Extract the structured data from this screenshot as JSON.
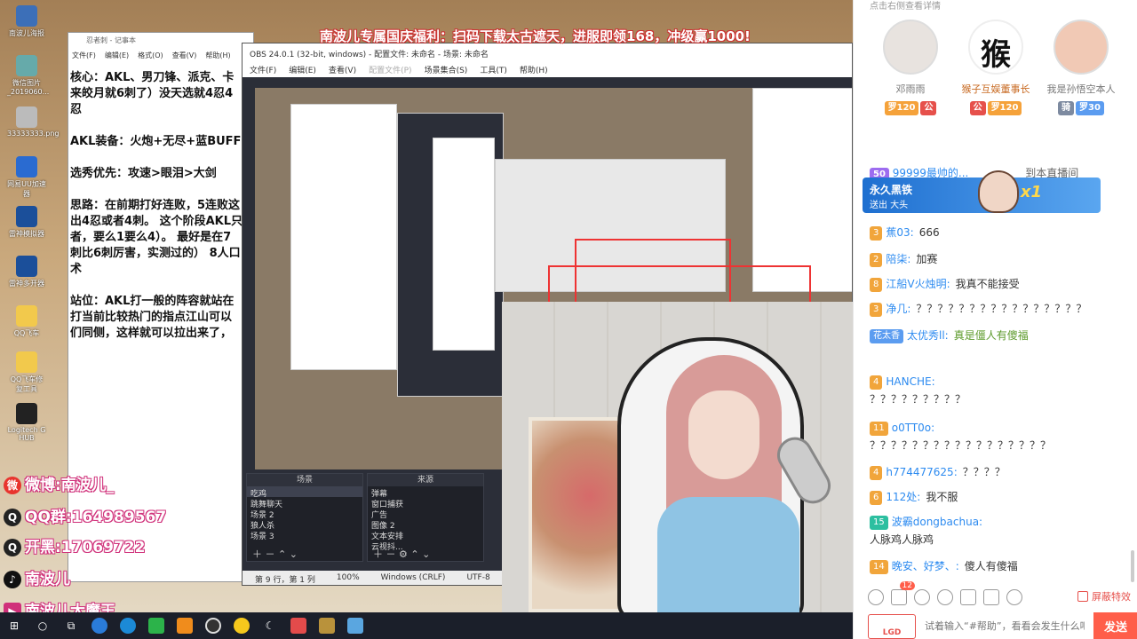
{
  "banner": "南波儿专属国庆福利：扫码下载太古遮天，进服即领168，冲级赢1000!",
  "desktop_icons": [
    {
      "label": "南波儿海报"
    },
    {
      "label": "微信图片_2019060..."
    },
    {
      "label": "33333333.png"
    },
    {
      "label": "网易UU加速器"
    },
    {
      "label": "雷神模拟器"
    },
    {
      "label": "雷神多开器"
    },
    {
      "label": "QQ飞车"
    },
    {
      "label": "QQ飞车修复工具"
    },
    {
      "label": "Logitech G HUB"
    }
  ],
  "notepad": {
    "title": "忍者刺 - 记事本",
    "menu": [
      "文件(F)",
      "编辑(E)",
      "格式(O)",
      "查看(V)",
      "帮助(H)"
    ],
    "content": "核心：AKL、男刀锋、派克、卡\n来皎月就6刺了）没天选就4忍4忍\n\nAKL装备：火炮+无尽+蓝BUFF\n\n选秀优先：攻速>眼泪>大剑\n\n思路：在前期打好连败，5连败这\n出4忍或者4刺。 这个阶段AKL只\n者，要么1要么4）。 最好是在7\n刺比6刺厉害，实测过的） 8人口\n术\n\n站位：AKL打一般的阵容就站在\n打当前比较热门的指点江山可以\n们同侧，这样就可以拉出来了，"
  },
  "obs": {
    "title": "OBS 24.0.1 (32-bit, windows) - 配置文件: 未命名 - 场景: 未命名",
    "menu": [
      "文件(F)",
      "编辑(E)",
      "查看(V)",
      "配置文件(P)",
      "场景集合(S)",
      "工具(T)",
      "帮助(H)"
    ],
    "scenes_header": "场景",
    "scenes": [
      "吃鸡",
      "跳舞聊天",
      "场景 2",
      "狼人杀",
      "场景 3"
    ],
    "sources_header": "来源",
    "sources": [
      "弹幕",
      "窗口捕获",
      "广告",
      "图像 2",
      "文本安排",
      "云视抖..."
    ],
    "status": [
      "第 9 行，第 1 列",
      "100%",
      "Windows (CRLF)",
      "UTF-8"
    ]
  },
  "overlay": {
    "weibo": "微博:南波儿_",
    "qq": "QQ群:164989567",
    "kaihei": "开黑:17069722",
    "tiktok": "南波儿",
    "bottom": "南波儿大魔王"
  },
  "taskbar": {
    "items": [
      "windows-icon",
      "search-icon",
      "task-view-icon",
      "kugou-icon",
      "edge-icon",
      "wechat-icon",
      "app-orange-icon",
      "obs-icon",
      "app-yellow-icon",
      "moon-icon",
      "app-red-icon",
      "lol-icon",
      "app-blue-icon"
    ]
  },
  "chat": {
    "top_label": "点击右侧查看详情",
    "rank": [
      {
        "name": "邓雨雨",
        "badges": [
          "罗120",
          "公"
        ]
      },
      {
        "name": "猴子互娱董事长",
        "badges": [
          "公",
          "罗120"
        ]
      },
      {
        "name": "我是孙悟空本人",
        "badges": [
          "骑",
          "罗30"
        ]
      }
    ],
    "behind_row": {
      "badge": "50",
      "user": "99999最帅的...",
      "text": "到本直播间"
    },
    "enter_notice": {
      "name": "永久黑铁",
      "line2": "送出  大头",
      "count": "x1"
    },
    "messages": [
      {
        "level": "3",
        "user": "蕉03:",
        "text": "666"
      },
      {
        "level": "2",
        "user": "陪柒:",
        "text": "加赛"
      },
      {
        "level": "8",
        "user": "江船V火烛明:",
        "text": "我真不能接受"
      },
      {
        "level": "3",
        "user": "净几:",
        "text": "？？？？？？？？？？？？？？？？"
      },
      {
        "level": "花太香",
        "user": "太优秀ll:",
        "text": "真是僵人有傻福"
      },
      {
        "level": "4",
        "user": "HANCHE:",
        "text": "？？？？？？？？？"
      },
      {
        "level": "11",
        "user": "o0TT0o:",
        "text": "？？？？？？？？？？？？？？？？？"
      },
      {
        "level": "4",
        "user": "h774477625:",
        "text": "？？？？"
      },
      {
        "level": "6",
        "user": "112处:",
        "text": "我不服"
      },
      {
        "level": "15",
        "user": "波霸dongbachua:",
        "text": "人脉鸡人脉鸡"
      },
      {
        "level": "14",
        "user": "晚安、好梦、:",
        "text": "傻人有傻福"
      }
    ],
    "toolbar": {
      "notification_count": "12",
      "block_effects": "屏蔽特效"
    },
    "input": {
      "placeholder": "试着输入“#帮助”，看看会发生什么吧",
      "lgd": "LGD",
      "send": "发送"
    }
  },
  "colors": {
    "accent": "#ff5e4a",
    "username": "#2d8bf0",
    "level": "#f1a53b"
  }
}
